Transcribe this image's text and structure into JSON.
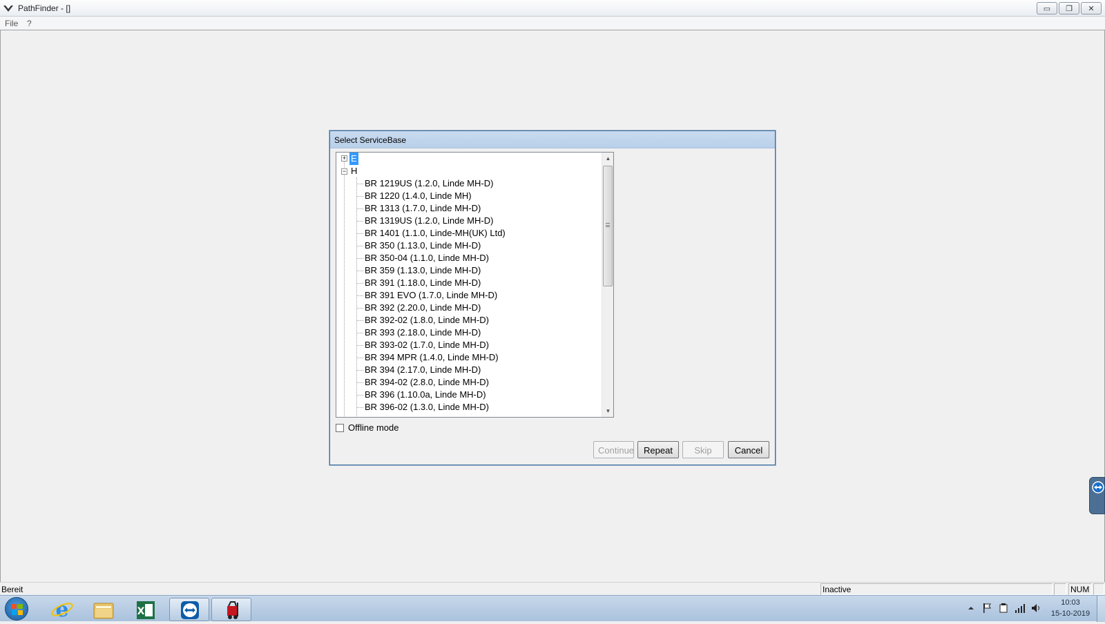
{
  "window": {
    "title": "PathFinder - []",
    "minimize_glyph": "▭",
    "restore_glyph": "❐",
    "close_glyph": "✕"
  },
  "menu": {
    "items": [
      "File",
      "?"
    ]
  },
  "dialog": {
    "title": "Select ServiceBase",
    "tree": {
      "nodes": [
        {
          "label": "E",
          "expanded": false,
          "expander": "+",
          "selected": true
        },
        {
          "label": "H",
          "expanded": true,
          "expander": "−",
          "selected": false
        }
      ],
      "children": [
        "BR 1219US (1.2.0, Linde MH-D)",
        "BR 1220 (1.4.0, Linde MH)",
        "BR 1313 (1.7.0, Linde MH-D)",
        "BR 1319US (1.2.0, Linde MH-D)",
        "BR 1401 (1.1.0, Linde-MH(UK) Ltd)",
        "BR 350 (1.13.0, Linde MH-D)",
        "BR 350-04 (1.1.0, Linde MH-D)",
        "BR 359 (1.13.0, Linde MH-D)",
        "BR 391 (1.18.0, Linde MH-D)",
        "BR 391 EVO (1.7.0, Linde MH-D)",
        "BR 392 (2.20.0, Linde MH-D)",
        "BR 392-02 (1.8.0, Linde MH-D)",
        "BR 393 (2.18.0, Linde MH-D)",
        "BR 393-02 (1.7.0, Linde MH-D)",
        "BR 394 MPR (1.4.0, Linde MH-D)",
        "BR 394 (2.17.0, Linde MH-D)",
        "BR 394-02 (2.8.0, Linde MH-D)",
        "BR 396 (1.10.0a, Linde MH-D)",
        "BR 396-02 (1.3.0, Linde MH-D)"
      ],
      "scroll_up_glyph": "▲",
      "scroll_down_glyph": "▼"
    },
    "offline_mode": {
      "label": "Offline mode",
      "checked": false
    },
    "buttons": {
      "continue": {
        "label": "Continue",
        "enabled": false
      },
      "repeat": {
        "label": "Repeat",
        "enabled": true
      },
      "skip": {
        "label": "Skip",
        "enabled": false
      },
      "cancel": {
        "label": "Cancel",
        "enabled": true
      }
    }
  },
  "statusbar": {
    "left": "Bereit",
    "state": "Inactive",
    "num": "NUM"
  },
  "taskbar": {
    "apps": [
      "internet-explorer",
      "file-explorer",
      "excel",
      "teamviewer",
      "pathfinder"
    ],
    "clock_time": "10:03",
    "clock_date": "15-10-2019"
  }
}
